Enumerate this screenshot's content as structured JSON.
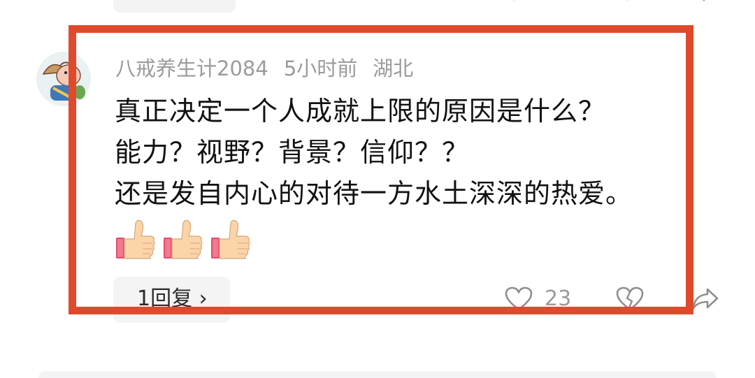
{
  "comment": {
    "username": "八戒养生计2084",
    "time": "5小时前",
    "location": "湖北",
    "lines": [
      "真正决定一个人成就上限的原因是什么？",
      "能力？视野？背景？信仰？？",
      "还是发自内心的对待一方水土深深的热爱。"
    ],
    "emojis": [
      "thumbs-up",
      "thumbs-up",
      "thumbs-up"
    ],
    "reply_label": "1回复 ›",
    "like_count": "23"
  },
  "colors": {
    "highlight_border": "#e04a2c",
    "meta_text": "#9b9b9b",
    "body_text": "#111111",
    "chip_bg": "#f4f4f4"
  },
  "icons": {
    "like": "heart-outline-icon",
    "dislike": "broken-heart-icon",
    "share": "share-arrow-icon",
    "avatar": "pig-character-avatar"
  }
}
